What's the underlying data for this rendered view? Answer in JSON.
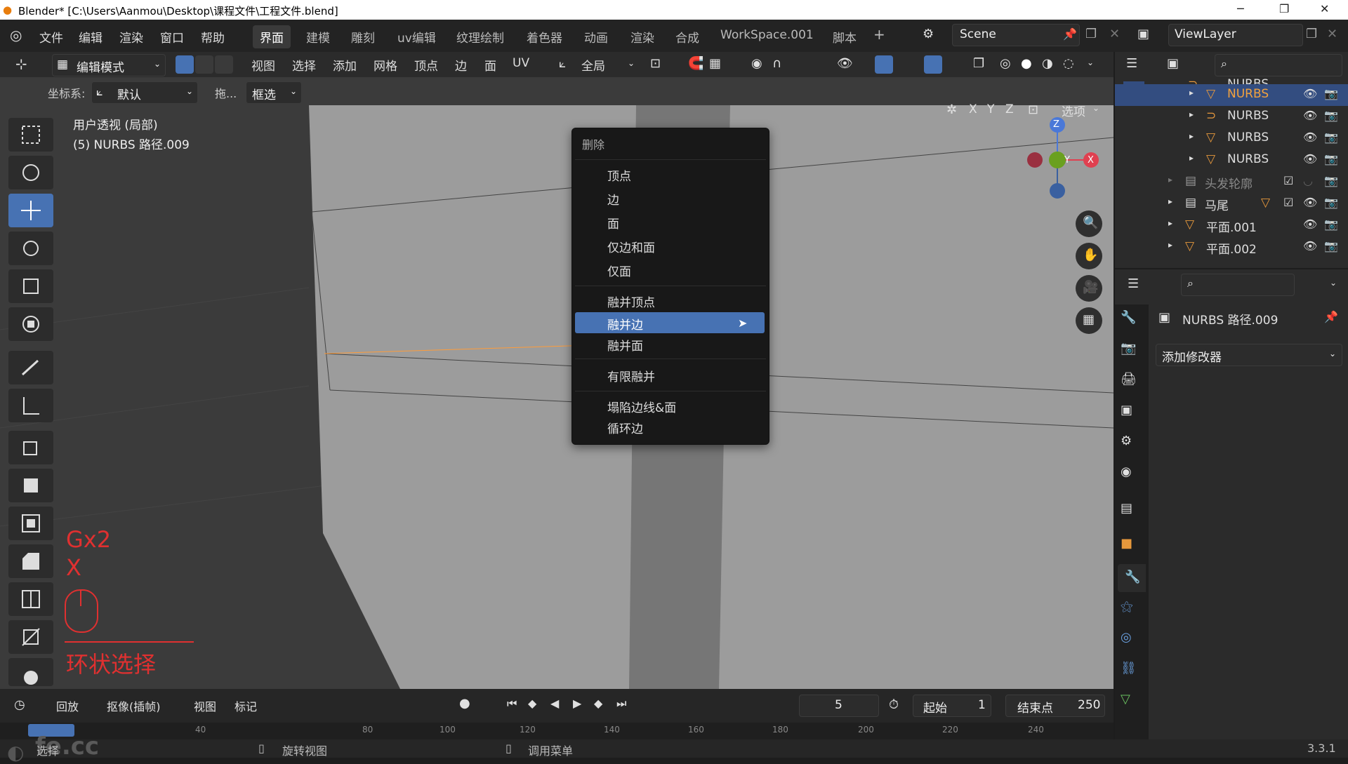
{
  "window": {
    "title": "Blender* [C:\\Users\\Aanmou\\Desktop\\课程文件\\工程文件.blend]"
  },
  "menu": {
    "file": "文件",
    "edit": "编辑",
    "render": "渲染",
    "window": "窗口",
    "help": "帮助"
  },
  "workspaces": [
    "界面",
    "建模",
    "雕刻",
    "uv编辑",
    "纹理绘制",
    "着色器",
    "动画",
    "渲染",
    "合成",
    "WorkSpace.001",
    "脚本"
  ],
  "scene": {
    "name": "Scene",
    "view_layer": "ViewLayer"
  },
  "header": {
    "mode": "编辑模式",
    "view": "视图",
    "select": "选择",
    "add": "添加",
    "mesh": "网格",
    "vertex": "顶点",
    "edge": "边",
    "face": "面",
    "uv": "UV",
    "transform_orientation": "全局",
    "coordinate_label": "坐标系:",
    "coordinate_value": "默认",
    "drag_label": "拖...",
    "select_mode": "框选",
    "axis_x": "X",
    "axis_y": "Y",
    "axis_z": "Z",
    "options": "选项"
  },
  "viewport": {
    "view_name": "用户透视 (局部)",
    "object_name": "(5) NURBS 路径.009",
    "overlay_keys_line1": "Gx2",
    "overlay_keys_line2": "X",
    "overlay_action": "环状选择",
    "gizmo_z": "Z",
    "gizmo_y": "Y",
    "gizmo_x": "X"
  },
  "context_menu": {
    "title": "删除",
    "items": [
      "顶点",
      "边",
      "面",
      "仅边和面",
      "仅面",
      "融并顶点",
      "融并边",
      "融并面",
      "有限融并",
      "塌陷边线&面",
      "循环边"
    ],
    "highlighted": "融并边"
  },
  "timeline": {
    "playback": "回放",
    "keying": "抠像(插帧)",
    "view": "视图",
    "marker": "标记",
    "current_frame": "5",
    "start_label": "起始",
    "start_value": "1",
    "end_label": "结束点",
    "end_value": "250",
    "ruler_ticks": [
      "40",
      "80",
      "100",
      "120",
      "140",
      "160",
      "180",
      "200",
      "220",
      "240"
    ]
  },
  "statusbar": {
    "select": "选择",
    "rotate": "旋转视图",
    "menu": "调用菜单",
    "version": "3.3.1"
  },
  "outliner": {
    "rows": [
      {
        "label": "NURBS",
        "selected": false
      },
      {
        "label": "NURBS",
        "selected": true
      },
      {
        "label": "NURBS",
        "selected": false
      },
      {
        "label": "NURBS",
        "selected": false
      },
      {
        "label": "NURBS",
        "selected": false
      },
      {
        "label": "头发轮廓",
        "selected": false
      },
      {
        "label": "马尾",
        "selected": false
      },
      {
        "label": "平面.001",
        "selected": false
      },
      {
        "label": "平面.002",
        "selected": false
      }
    ]
  },
  "properties": {
    "object_name": "NURBS 路径.009",
    "add_modifier": "添加修改器"
  },
  "watermark": "fe.cc",
  "colors": {
    "accent": "#4772b3",
    "selected_row": "#334d80",
    "menu_bg": "#181818",
    "overlay_red": "#e03030"
  }
}
